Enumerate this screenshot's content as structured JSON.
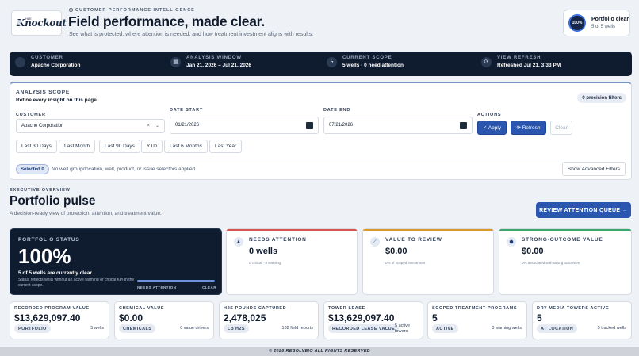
{
  "brand": {
    "logo_small": "HLE",
    "logo_text": "Knockout"
  },
  "header": {
    "eyebrow": "CUSTOMER PERFORMANCE INTELLIGENCE",
    "title": "Field performance, made clear.",
    "subtitle": "See what is protected, where attention is needed, and how treatment investment aligns with results."
  },
  "portfolio_badge": {
    "ring": "100%",
    "title": "Portfolio clear",
    "subtitle": "5 of 5 wells"
  },
  "context_bar": [
    {
      "label": "CUSTOMER",
      "value": "Apache Corporation",
      "icon": "circle-icon"
    },
    {
      "label": "ANALYSIS WINDOW",
      "value": "Jan 21, 2026 – Jul 21, 2026",
      "icon": "calendar-icon"
    },
    {
      "label": "CURRENT SCOPE",
      "value": "5 wells · 0 need attention",
      "icon": "bolt-icon"
    },
    {
      "label": "VIEW REFRESH",
      "value": "Refreshed Jul 21, 3:33 PM",
      "icon": "refresh-icon"
    }
  ],
  "scope": {
    "title": "ANALYSIS SCOPE",
    "subtitle": "Refine every insight on this page",
    "precision": "0 precision filters",
    "customer_label": "CUSTOMER",
    "customer_value": "Apache Corporation",
    "date_start_label": "DATE START",
    "date_start_value": "01/21/2026",
    "date_end_label": "DATE END",
    "date_end_value": "07/21/2026",
    "actions_label": "ACTIONS",
    "apply": "✓ Apply",
    "refresh": "⟳ Refresh",
    "clear": "Clear",
    "presets": [
      "Last 30 Days",
      "Last Month",
      "Last 90 Days",
      "YTD",
      "Last 6 Months",
      "Last Year"
    ],
    "selected_badge": "Selected 0",
    "selected_text": "No well group/location, well, product, or issue selectors applied.",
    "advanced": "Show Advanced Filters"
  },
  "overview": {
    "eyebrow": "EXECUTIVE OVERVIEW",
    "title": "Portfolio pulse",
    "subtitle": "A decision-ready view of protection, attention, and treatment value.",
    "review_button": "REVIEW ATTENTION QUEUE →"
  },
  "status_card": {
    "label": "PORTFOLIO STATUS",
    "value": "100%",
    "strong": "5 of 5 wells are currently clear",
    "desc": "Status reflects wells without an active warning or critical KPI in the current scope.",
    "bar_left": "NEEDS ATTENTION",
    "bar_right": "CLEAR",
    "bar_fraction": 1.0
  },
  "metric_cards": [
    {
      "label": "NEEDS ATTENTION",
      "value": "0 wells",
      "desc": "0 critical · 0 warning",
      "color": "#d9534f",
      "icon": "warning-icon"
    },
    {
      "label": "VALUE TO REVIEW",
      "value": "$0.00",
      "desc": "0% of scoped investment",
      "color": "#d99a2b",
      "icon": "chart-icon"
    },
    {
      "label": "STRONG-OUTCOME VALUE",
      "value": "$0.00",
      "desc": "0% associated with strong outcomes",
      "color": "#3aa76d",
      "icon": "shield-icon"
    }
  ],
  "stat_cards": [
    {
      "label": "RECORDED PROGRAM VALUE",
      "value": "$13,629,097.40",
      "tag": "PORTFOLIO",
      "note": "5 wells"
    },
    {
      "label": "CHEMICAL VALUE",
      "value": "$0.00",
      "tag": "CHEMICALS",
      "note": "0 value drivers"
    },
    {
      "label": "H2S POUNDS CAPTURED",
      "value": "2,478,025",
      "tag": "LB H2S",
      "note": "182 field reports"
    },
    {
      "label": "TOWER LEASE",
      "value": "$13,629,097.40",
      "tag": "RECORDED LEASE VALUE",
      "note": "5 active towers"
    },
    {
      "label": "SCOPED TREATMENT PROGRAMS",
      "value": "5",
      "tag": "ACTIVE",
      "note": "0 warning wells"
    },
    {
      "label": "DRY MEDIA TOWERS ACTIVE",
      "value": "5",
      "tag": "AT LOCATION",
      "note": "5 tracked wells"
    }
  ],
  "footer": "© 2026 RESOLVEIO ALL RIGHTS RESERVED"
}
